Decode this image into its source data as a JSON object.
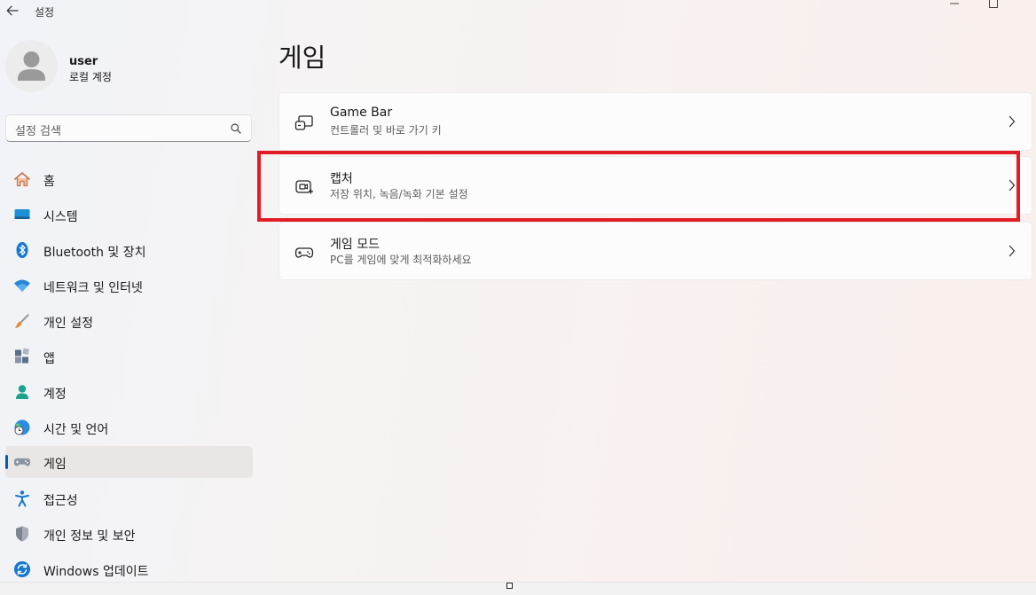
{
  "window": {
    "title": "설정"
  },
  "profile": {
    "name": "user",
    "account_type": "로컬 계정"
  },
  "search": {
    "placeholder": "설정 검색"
  },
  "sidebar": {
    "items": [
      {
        "label": "홈",
        "icon": "home-icon"
      },
      {
        "label": "시스템",
        "icon": "monitor-icon"
      },
      {
        "label": "Bluetooth 및 장치",
        "icon": "bluetooth-icon"
      },
      {
        "label": "네트워크 및 인터넷",
        "icon": "wifi-icon"
      },
      {
        "label": "개인 설정",
        "icon": "paintbrush-icon"
      },
      {
        "label": "앱",
        "icon": "apps-icon"
      },
      {
        "label": "계정",
        "icon": "person-icon"
      },
      {
        "label": "시간 및 언어",
        "icon": "globe-clock-icon"
      },
      {
        "label": "게임",
        "icon": "gamepad-icon",
        "selected": true
      },
      {
        "label": "접근성",
        "icon": "accessibility-icon"
      },
      {
        "label": "개인 정보 및 보안",
        "icon": "shield-icon"
      },
      {
        "label": "Windows 업데이트",
        "icon": "sync-icon"
      }
    ]
  },
  "main": {
    "title": "게임",
    "cards": [
      {
        "title": "Game Bar",
        "subtitle": "컨트롤러 및 바로 가기 키",
        "icon": "game-bar-icon"
      },
      {
        "title": "캡처",
        "subtitle": "저장 위치, 녹음/녹화 기본 설정",
        "icon": "capture-icon",
        "highlighted": true
      },
      {
        "title": "게임 모드",
        "subtitle": "PC를 게임에 맞게 최적화하세요",
        "icon": "controller-icon"
      }
    ]
  },
  "colors": {
    "accent": "#005fb8",
    "highlight": "#e21c24"
  }
}
